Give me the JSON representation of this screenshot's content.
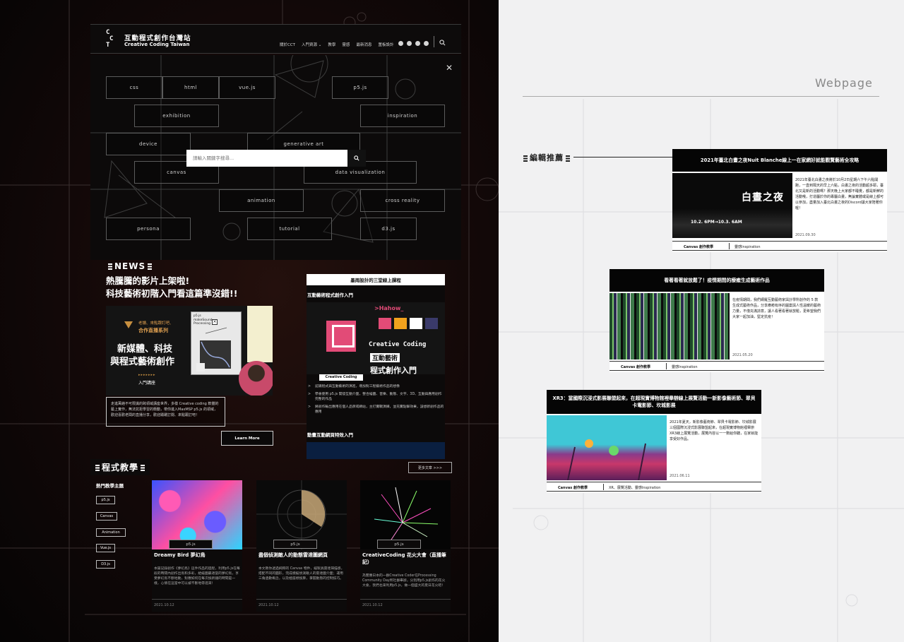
{
  "header": {
    "title_zh": "互動程式創作台灣站",
    "title_en": "Creative Coding Taiwan",
    "logo_letters": [
      "C",
      "C",
      "T"
    ],
    "nav": [
      "關於CCT",
      "入門資源 ⌄",
      "教學",
      "靈感",
      "最新消息",
      "置板設計"
    ],
    "social_icons": [
      "facebook-icon",
      "instagram-icon",
      "twitter-icon",
      "youtube-icon"
    ]
  },
  "tag_search": {
    "tags": [
      "css",
      "html",
      "vue.js",
      "p5.js",
      "exhibition",
      "inspiration",
      "device",
      "generative art",
      "canvas",
      "data visualization",
      "animation",
      "cross reality",
      "persona",
      "tutorial",
      "d3.js"
    ],
    "placeholder": "請輸入關鍵字搜尋..."
  },
  "news": {
    "heading": "NEWS",
    "headline": "熱騰騰的影片上架啦!\n科技藝術初階入門看這篇準沒錯!!",
    "image": {
      "series_line1": "老讀、來點跟訂吧、",
      "series_line2": "合作直播系列",
      "title_line1": "新媒體、科技",
      "title_line2": "與程式藝術創作",
      "course": "入門講座",
      "screen_label": "p5.js\nmakeSound\nProcessing"
    },
    "caption": "走進萬絡不可限識的跨領域講座世界，多樣 Creative coding 軟體的藝上實作，無法抗拒學習的衝動，帶你進入MaxMSP p5.js 的領域，歡迎喜歡老闆的直播分享，歡迎踴躍訂閱、來點跟訂吧！",
    "learn_more": "Learn More"
  },
  "course_card": {
    "title": "墨雨設計的三堂線上課程",
    "subtitle": "互動藝術程式創作入門",
    "banner": {
      "brand": ">Hahow_",
      "title_en": "Creative Coding",
      "title_zh1": "互動藝術",
      "title_zh2": "程式創作入門",
      "label": "Creative Coding"
    },
    "bullets": [
      "認識程式與互動藝術的演進，增加對工程藝術作品的想像",
      "學會使用 p5.js 開發互動介面，整合繪圖、音樂、動態、文字、3D、互動與應用創作完整的作品",
      "將創作輸出應用在個人品牌或網站，主打實戰演練，並充實點擊效果，設想新創作品的應用"
    ],
    "subtitle2": "動畫互動網頁特效入門"
  },
  "tutorials": {
    "heading": "程式教學",
    "more": "更多文章 >>>",
    "topics_title": "熱門教學主題",
    "topics": [
      "p5.js",
      "Canvas",
      "Animation",
      "Vue.js",
      "D3.js"
    ],
    "articles": [
      {
        "tag": "p5.js",
        "title": "Dreamy Bird 夢幻鳥",
        "excerpt": "本篇記錄創作《夢幻鳥》這件作品的過程，利用p5.js在每段的時間內創作出鳥和多彩，給繪圖最適當的夢幻鳥，享受夢幻鳥不斷地動，對應如何在每次換新鐘的時間是一樣，心情在這當中可以被不斷地帶進來！",
        "date": "2021.10.12"
      },
      {
        "tag": "p5.js",
        "title": "盡個偵測敵人的動態雷達圖網頁",
        "excerpt": "本文教你透過純粹的 Canvas 物件，繪製具雷達掃描感，搭配不同的圓形，完成模擬偵測敵人的雷達圖介面；運用三角函數概念，以及極座標換算，掌握動態的控制技巧。",
        "date": "2021.10.12"
      },
      {
        "tag": "p5.js",
        "title": "CreativeCoding 花火大會（直播筆記）",
        "excerpt": "為響應日本的一群Creative Coder在Processing Community Day所社群舉辦，分別用p5.js創作的花火大會，我們也來利用p5.js，做一個盛大的夏日花火吧！",
        "date": "2021.10.12"
      }
    ]
  },
  "right": {
    "webpage_label": "Webpage",
    "editor_picks": "編輯推薦",
    "cards": [
      {
        "title": "2021年臺北白晝之夜Nuit Blanche線上一在家網好就能觀覽藝術全攻略",
        "image_text": "白晝之夜",
        "image_dates": "10.2. 6PM→10.3. 6AM",
        "text": "2021年臺北白晝之夜將於10月2日星期六下午六點開跑，一直到隔天的早上六點，白晝之夜的活動超多耶，臺北又是新的活動嗎？那天晚上大家都不睡覺，都是新鮮的活動哦，打造屬於你的專屬白晝，無論實體或是線上都可以參加，盡量加入臺北白晝之夜的Discord讓大家陪著你喔！",
        "date": "2021.09.30",
        "category": "Canvas 創作教學",
        "tags": "靈感Inspiration"
      },
      {
        "title": "看著看著就放鬆了！疫情期間的療癒生成藝術作品",
        "text": "在疫情期間，我們網羅互動藝術家與計學所創作的 5 款生成式藝術作品，分享療癒有序的圖案與人性溫暖的藝術力量，不僅充滿詩意，讓人看著看著就放鬆，更希望我們大家一起加油，堅定抗疫！",
        "date": "2021.05.20",
        "category": "Canvas 創作教學",
        "tags": "靈感Inspiration"
      },
      {
        "title": "XR3：當國際沉浸式影展聯盟起來，在超現實博物館裡舉辦線上展覽活動一新影像藝術節、翠貝卡電影節、坎城影展",
        "text": "2021年夏天，新影像藝術節、翠貝卡電影節、坎城影展三個國際沉浸式影展聯盟起來，在超現實博物館裡舉辦XR3線上展覽活動，展覽內容以一一數給你聽，在家就能享受好作品。",
        "date": "2021.06.11",
        "category": "Canvas 創作教學",
        "tags": "XR、展覽活動、靈感Inspiration"
      }
    ]
  },
  "colors": {
    "accent_pink": "#e24b77",
    "accent_gold": "#c89040",
    "dark_bg": "#0c0a0a",
    "light_bg": "#f1f1f2"
  }
}
